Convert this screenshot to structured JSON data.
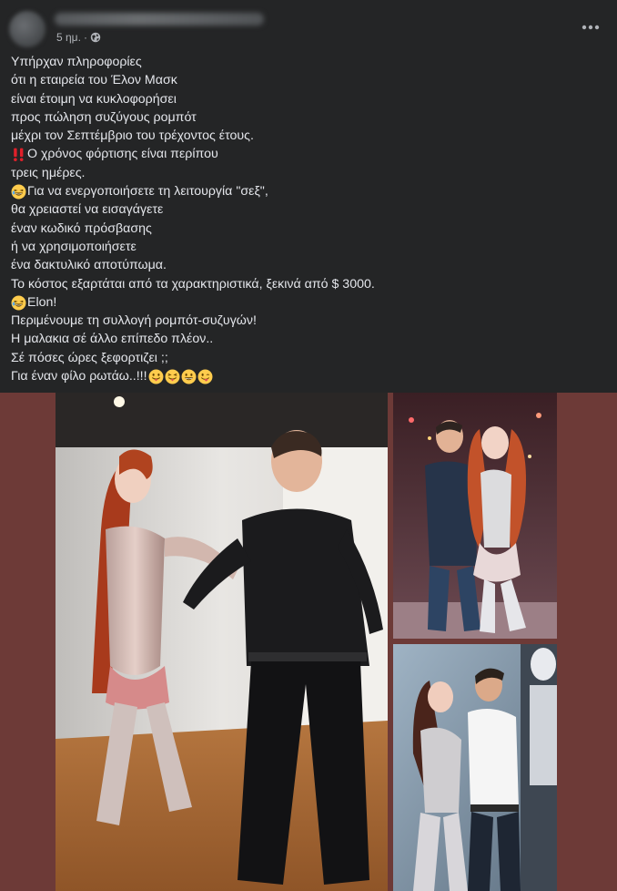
{
  "post": {
    "timestamp": "5 ημ.",
    "separator": "·",
    "privacy_icon": "globe-icon",
    "more_icon": "more-horizontal-icon",
    "lines": [
      {
        "text": "Υπήρχαν πληροφορίες"
      },
      {
        "text": "ότι η εταιρεία του Έλον Μασκ"
      },
      {
        "text": "είναι έτοιμη να κυκλοφορήσει"
      },
      {
        "text": "προς πώληση συζύγους ρομπότ"
      },
      {
        "text": "μέχρι τον Σεπτέμβριο του τρέχοντος έτους."
      },
      {
        "text": "Ο χρόνος φόρτισης είναι περίπου",
        "prefix_emoji": "double-exclamation-emoji"
      },
      {
        "text": "τρεις ημέρες."
      },
      {
        "text": "Για να ενεργοποιήσετε τη λειτουργία \"σεξ\",",
        "prefix_emoji": "laughing-emoji"
      },
      {
        "text": "θα χρειαστεί να εισαγάγετε"
      },
      {
        "text": "έναν κωδικό πρόσβασης"
      },
      {
        "text": "ή να χρησιμοποιήσετε"
      },
      {
        "text": "ένα δακτυλικό αποτύπωμα."
      },
      {
        "text": "Το κόστος εξαρτάται από τα χαρακτηριστικά, ξεκινά από $ 3000."
      },
      {
        "text": "Elon!",
        "prefix_emoji": "laughing-emoji"
      },
      {
        "text": "Περιμένουμε τη συλλογή ρομπότ-συζυγών!"
      },
      {
        "text": "Η μαλακια σέ άλλο επίπεδο πλέον.."
      },
      {
        "text": "Σέ πόσες ώρες ξεφορτιζει ;;"
      },
      {
        "text": "Για έναν φίλο ρωτάω..!!!",
        "suffix_emojis": [
          "tongue-out-emoji",
          "squinting-tongue-emoji",
          "grinning-emoji",
          "winking-tongue-emoji"
        ]
      }
    ]
  },
  "colors": {
    "card_background": "#242526",
    "primary_text": "#e4e6eb",
    "secondary_text": "#b0b3b8",
    "media_background": "#6d3a37",
    "emoji_yellow": "#ffcc4d",
    "emoji_red": "#e0202a"
  },
  "photos": [
    {
      "name": "main-photo"
    },
    {
      "name": "top-right-photo"
    },
    {
      "name": "bottom-right-photo"
    }
  ]
}
